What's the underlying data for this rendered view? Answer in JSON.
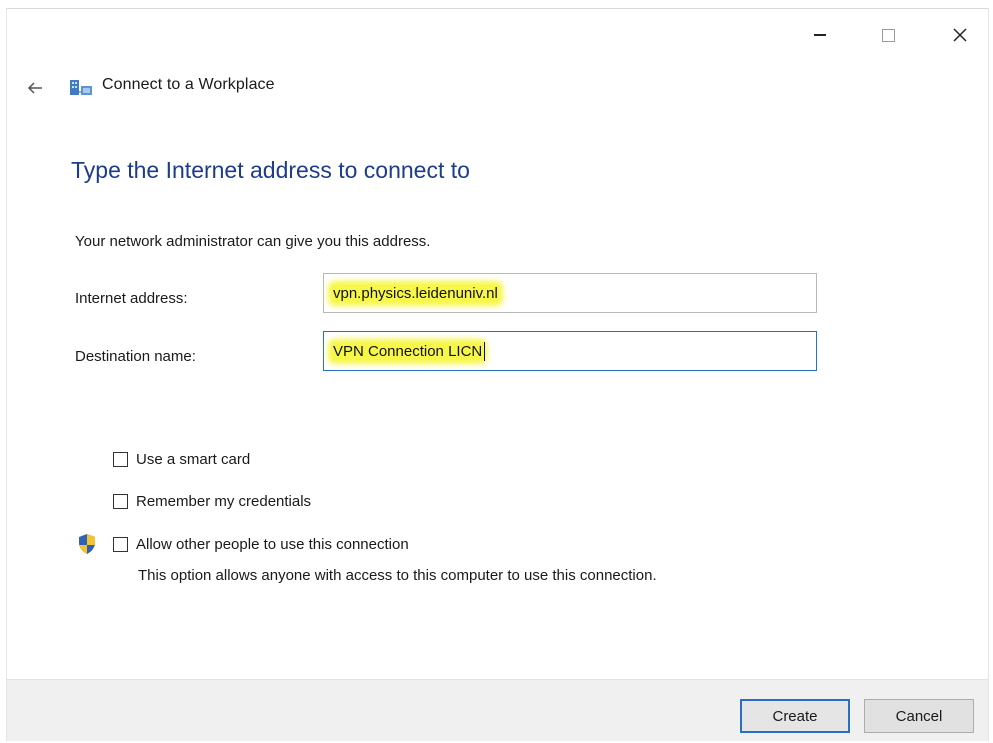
{
  "window": {
    "controls": {
      "minimize_icon": "minimize-icon",
      "maximize_icon": "maximize-icon",
      "close_icon": "close-icon"
    },
    "title": "Connect to a Workplace"
  },
  "main": {
    "heading": "Type the Internet address to connect to",
    "subtitle": "Your network administrator can give you this address.",
    "fields": {
      "address_label": "Internet address:",
      "address_value": "vpn.physics.leidenuniv.nl",
      "dest_label": "Destination name:",
      "dest_value": "VPN Connection LICN"
    },
    "options": {
      "smart_card": "Use a smart card",
      "remember": "Remember my credentials",
      "allow_others": "Allow other people to use this connection",
      "allow_helper": "This option allows anyone with access to this computer to use this connection."
    }
  },
  "footer": {
    "create_label": "Create",
    "cancel_label": "Cancel"
  },
  "colors": {
    "heading": "#1e3c8c",
    "accent_blue": "#2b6fc1",
    "highlight": "#f7f74a",
    "footer_bg": "#f0f0f0"
  }
}
